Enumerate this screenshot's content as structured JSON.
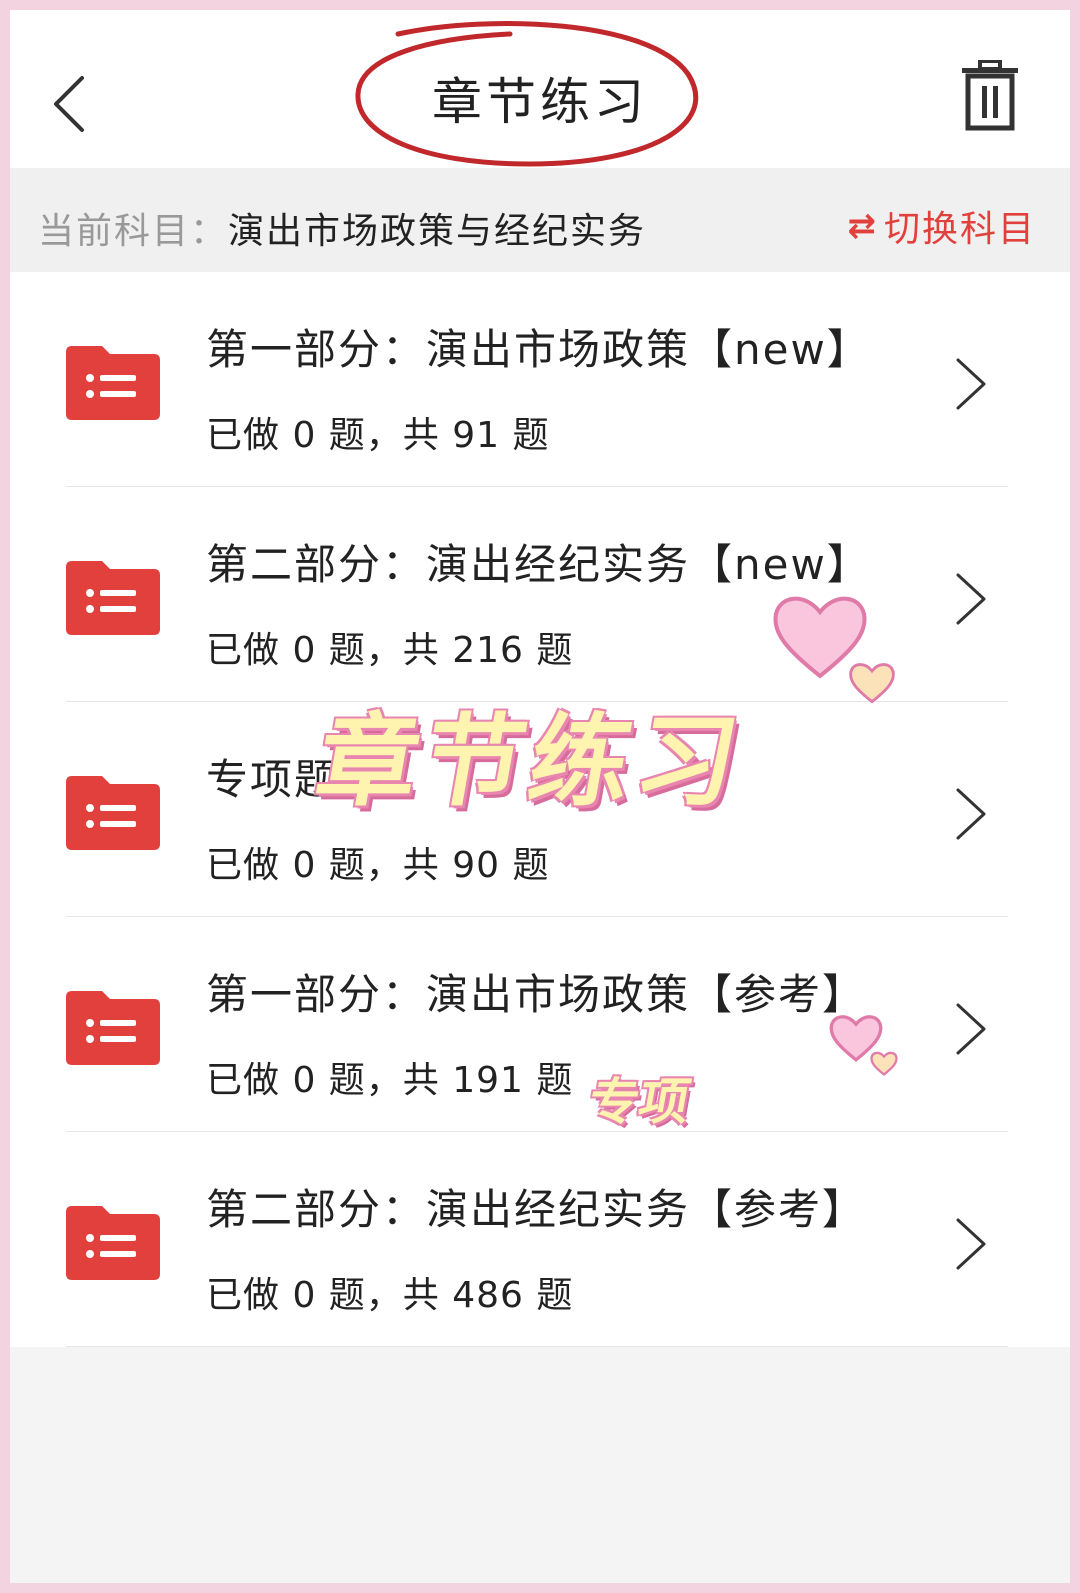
{
  "header": {
    "title": "章节练习",
    "icons": {
      "back": "chevron-left-icon",
      "trash": "trash-icon"
    }
  },
  "subject": {
    "label": "当前科目：",
    "name": "演出市场政策与经纪实务",
    "switch_label": "切换科目",
    "switch_icon": "swap-arrows-icon"
  },
  "chapters": [
    {
      "title": "第一部分：演出市场政策【new】",
      "count": "已做 0 题，共 91 题"
    },
    {
      "title": "第二部分：演出经纪实务【new】",
      "count": "已做 0 题，共 216 题"
    },
    {
      "title": "专项题",
      "count": "已做 0 题，共 90 题"
    },
    {
      "title": "第一部分：演出市场政策【参考】",
      "count": "已做 0 题，共 191 题"
    },
    {
      "title": "第二部分：演出经纪实务【参考】",
      "count": "已做 0 题，共 486 题"
    }
  ],
  "overlay": {
    "sticker_main": "章节练习",
    "sticker_small": "专项"
  },
  "colors": {
    "accent": "#e2403c",
    "folder": "#e2403c",
    "border_pink": "#f3d3df",
    "sticker_fill": "#fff3b0",
    "sticker_outline": "#e986b0"
  }
}
